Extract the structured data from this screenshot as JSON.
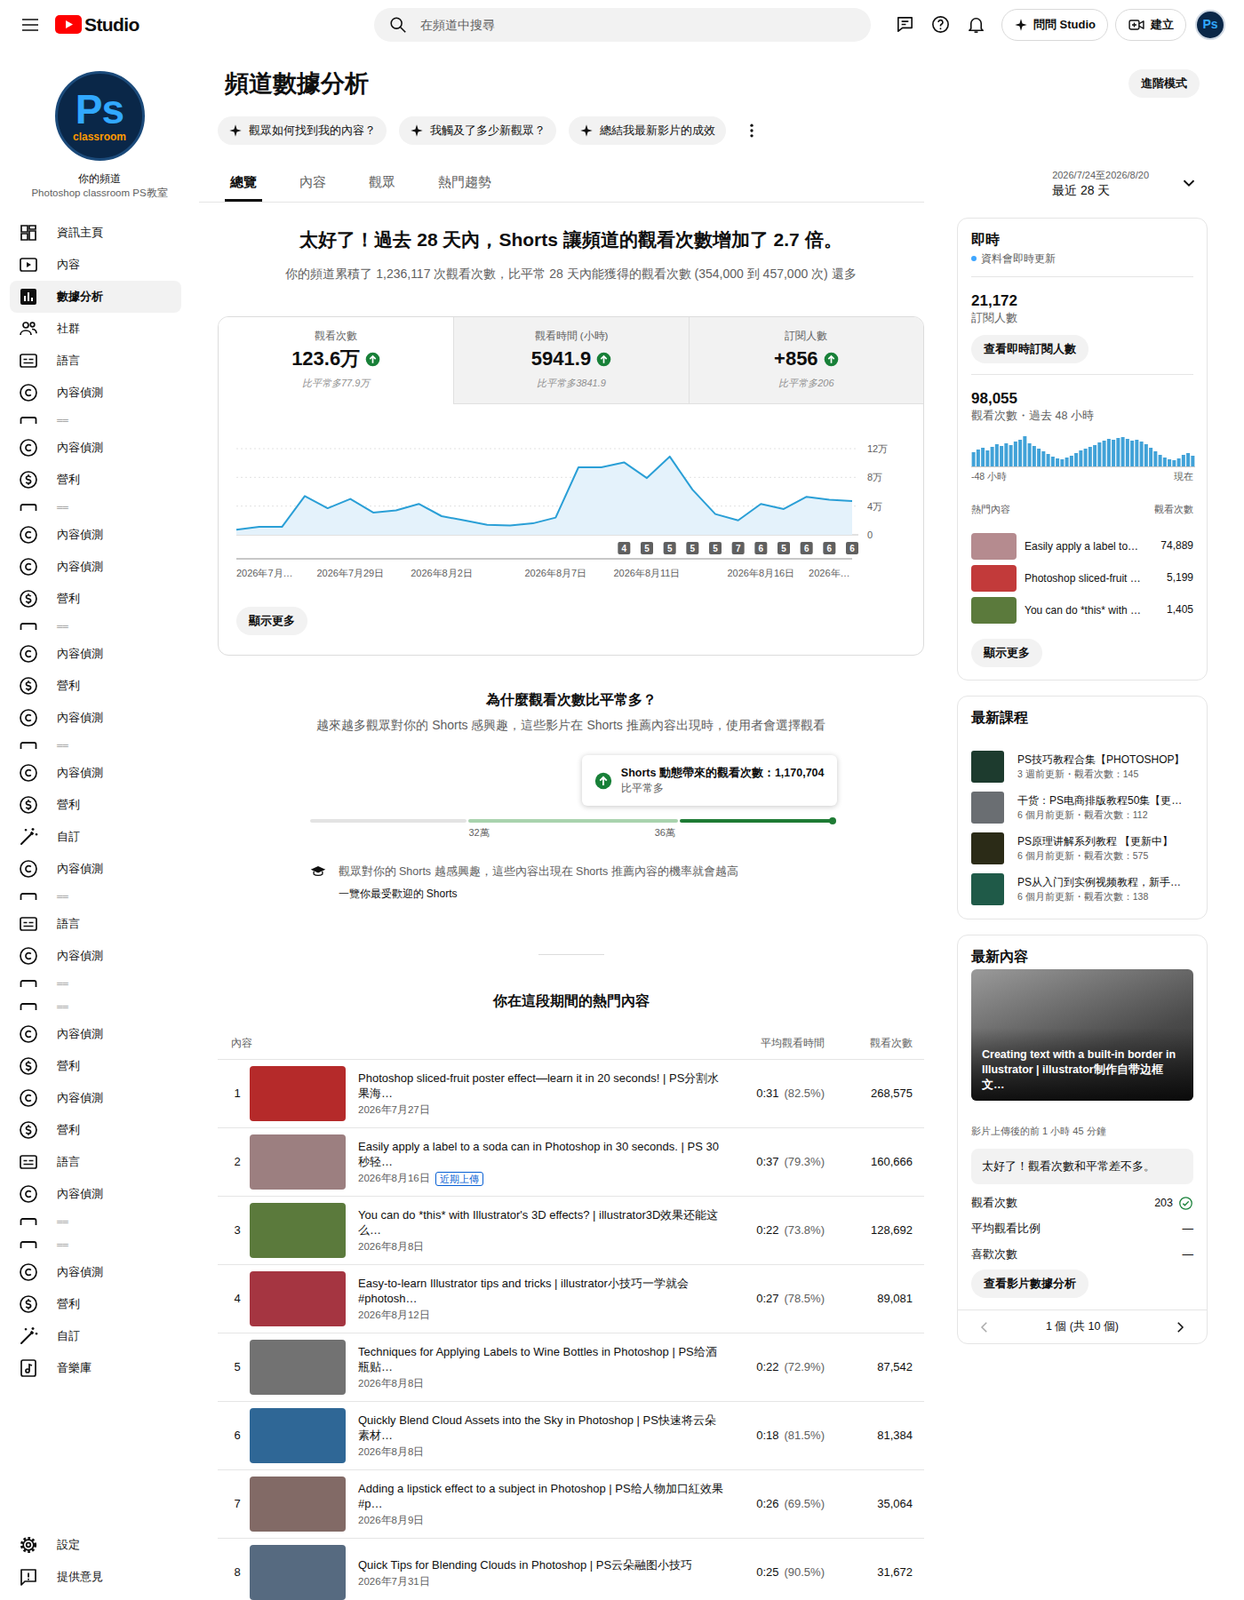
{
  "topbar": {
    "logo": "Studio",
    "search": {
      "placeholder": "在頻道中搜尋"
    },
    "ask_button": "問問 Studio",
    "create_button": "建立",
    "avatar": "Ps"
  },
  "channel": {
    "avatar_text": "Ps",
    "avatar_sub": "classroom",
    "label": "你的頻道",
    "name": "Photoshop classroom PS教室"
  },
  "sidebar": {
    "items": [
      {
        "kind": "dashboard",
        "label": "資訊主頁",
        "selected": false
      },
      {
        "kind": "content",
        "label": "內容",
        "selected": false
      },
      {
        "kind": "analytics",
        "label": "數據分析",
        "selected": true
      },
      {
        "kind": "community",
        "label": "社群",
        "selected": false
      },
      {
        "kind": "subtitles",
        "label": "語言",
        "selected": false
      },
      {
        "kind": "copyright",
        "label": "內容偵測",
        "selected": false
      },
      {
        "kind": "fragment",
        "label": "══",
        "selected": false
      },
      {
        "kind": "copyright",
        "label": "內容偵測",
        "selected": false
      },
      {
        "kind": "monetization",
        "label": "營利",
        "selected": false
      },
      {
        "kind": "fragment",
        "label": "══",
        "selected": false
      },
      {
        "kind": "copyright",
        "label": "內容偵測",
        "selected": false
      },
      {
        "kind": "copyright",
        "label": "內容偵測",
        "selected": false
      },
      {
        "kind": "monetization",
        "label": "營利",
        "selected": false
      },
      {
        "kind": "fragment",
        "label": "══",
        "selected": false
      },
      {
        "kind": "copyright",
        "label": "內容偵測",
        "selected": false
      },
      {
        "kind": "monetization",
        "label": "營利",
        "selected": false
      },
      {
        "kind": "copyright",
        "label": "內容偵測",
        "selected": false
      },
      {
        "kind": "fragment",
        "label": "══",
        "selected": false
      },
      {
        "kind": "copyright",
        "label": "內容偵測",
        "selected": false
      },
      {
        "kind": "monetization",
        "label": "營利",
        "selected": false
      },
      {
        "kind": "customization",
        "label": "自訂",
        "selected": false
      },
      {
        "kind": "copyright",
        "label": "內容偵測",
        "selected": false
      },
      {
        "kind": "fragment",
        "label": "══",
        "selected": false
      },
      {
        "kind": "subtitles",
        "label": "語言",
        "selected": false
      },
      {
        "kind": "copyright",
        "label": "內容偵測",
        "selected": false
      },
      {
        "kind": "fragment",
        "label": "══",
        "selected": false
      },
      {
        "kind": "fragment",
        "label": "══",
        "selected": false
      },
      {
        "kind": "copyright",
        "label": "內容偵測",
        "selected": false
      },
      {
        "kind": "monetization",
        "label": "營利",
        "selected": false
      },
      {
        "kind": "copyright",
        "label": "內容偵測",
        "selected": false
      },
      {
        "kind": "monetization",
        "label": "營利",
        "selected": false
      },
      {
        "kind": "subtitles",
        "label": "語言",
        "selected": false
      },
      {
        "kind": "copyright",
        "label": "內容偵測",
        "selected": false
      },
      {
        "kind": "fragment",
        "label": "══",
        "selected": false
      },
      {
        "kind": "fragment",
        "label": "══",
        "selected": false
      },
      {
        "kind": "copyright",
        "label": "內容偵測",
        "selected": false
      },
      {
        "kind": "monetization",
        "label": "營利",
        "selected": false
      },
      {
        "kind": "customization",
        "label": "自訂",
        "selected": false
      },
      {
        "kind": "audio",
        "label": "音樂庫",
        "selected": false
      }
    ],
    "footer": [
      {
        "kind": "settings",
        "label": "設定",
        "selected": false
      },
      {
        "kind": "feedback",
        "label": "提供意見",
        "selected": false
      }
    ]
  },
  "header": {
    "title": "頻道數據分析",
    "advanced_button": "進階模式",
    "chips": [
      "觀眾如何找到我的內容？",
      "我觸及了多少新觀眾？",
      "總結我最新影片的成效"
    ],
    "tabs": [
      {
        "label": "總覽",
        "selected": true
      },
      {
        "label": "內容",
        "selected": false
      },
      {
        "label": "觀眾",
        "selected": false
      },
      {
        "label": "熱門趨勢",
        "selected": false
      }
    ],
    "date_range": {
      "dates": "2026/7/24至2026/8/20",
      "label": "最近 28 天"
    }
  },
  "summary": {
    "headline": "太好了！過去 28 天內，Shorts 讓頻道的觀看次數增加了 2.7 倍。",
    "subtitle": "你的頻道累積了 1,236,117 次觀看次數，比平常 28 天內能獲得的觀看次數 (354,000 到 457,000 次) 還多"
  },
  "metrics": [
    {
      "label": "觀看次數",
      "value": "123.6万",
      "compare": "比平常多77.9万",
      "up": true,
      "selected": true
    },
    {
      "label": "觀看時間 (小時)",
      "value": "5941.9",
      "compare": "比平常多3841.9",
      "up": true,
      "selected": false
    },
    {
      "label": "訂閱人數",
      "value": "+856",
      "compare": "比平常多206",
      "up": true,
      "selected": false
    }
  ],
  "chart": {
    "y_ticks": [
      {
        "label": "12万",
        "value": 12
      },
      {
        "label": "8万",
        "value": 8
      },
      {
        "label": "4万",
        "value": 4
      },
      {
        "label": "0",
        "value": 0
      }
    ],
    "values": [
      0.7,
      1.1,
      1.1,
      5.4,
      3.7,
      5.0,
      3.1,
      3.4,
      4.3,
      2.6,
      2.0,
      1.4,
      1.3,
      1.6,
      2.4,
      9.4,
      9.4,
      10.1,
      7.9,
      10.9,
      6.3,
      2.9,
      2.0,
      4.3,
      3.6,
      5.3,
      4.9,
      4.7
    ],
    "x_labels": [
      {
        "label": "2026年7月…",
        "index": 0
      },
      {
        "label": "2026年7月29日",
        "index": 5
      },
      {
        "label": "2026年8月2日",
        "index": 9
      },
      {
        "label": "2026年8月7日",
        "index": 14
      },
      {
        "label": "2026年8月11日",
        "index": 18
      },
      {
        "label": "2026年8月16日",
        "index": 23
      },
      {
        "label": "2026年…",
        "index": 26
      }
    ],
    "markers": [
      {
        "label": "4",
        "index": 17
      },
      {
        "label": "5",
        "index": 18
      },
      {
        "label": "5",
        "index": 19
      },
      {
        "label": "5",
        "index": 20
      },
      {
        "label": "5",
        "index": 21
      },
      {
        "label": "7",
        "index": 22
      },
      {
        "label": "6",
        "index": 23
      },
      {
        "label": "5",
        "index": 24
      },
      {
        "label": "6",
        "index": 25
      },
      {
        "label": "6",
        "index": 26
      },
      {
        "label": "6",
        "index": 27
      }
    ],
    "more_button": "顯示更多"
  },
  "why": {
    "title": "為什麼觀看次數比平常多？",
    "subtitle": "越來越多觀眾對你的 Shorts 感興趣，這些影片在 Shorts 推薦內容出現時，使用者會選擇觀看",
    "tooltip": {
      "text": "Shorts 動態帶來的觀看次數：1,170,704",
      "sub": "比平常多",
      "up": true
    },
    "range": {
      "segments": [
        {
          "share": 0.303,
          "color": "#e3e3e3"
        },
        {
          "share": 0.404,
          "color": "#a9d3ae"
        },
        {
          "share": 0.293,
          "color": "#1e7b34"
        }
      ],
      "labels": [
        {
          "label": "32萬",
          "position": 0.324
        },
        {
          "label": "36萬",
          "position": 0.68
        }
      ]
    },
    "tip": {
      "text": "觀眾對你的 Shorts 越感興趣，這些內容出現在 Shorts 推薦內容的機率就會越高",
      "link": "一覽你最受歡迎的 Shorts"
    }
  },
  "top_content": {
    "title": "你在這段期間的熱門內容",
    "columns": [
      "內容",
      "平均觀看時間",
      "觀看次數"
    ],
    "rows": [
      {
        "rank": "1",
        "title": "Photoshop sliced-fruit poster effect—learn it in 20 seconds! | PS分割水果海…",
        "date": "2026年7月27日",
        "avg": "0:31",
        "avg_pct": "(82.5%)",
        "views": "268,575",
        "color": "#b52a2a"
      },
      {
        "rank": "2",
        "title": "Easily apply a label to a soda can in Photoshop in 30 seconds. | PS 30秒轻…",
        "date": "2026年8月16日",
        "badge": "近期上傳",
        "avg": "0:37",
        "avg_pct": "(79.3%)",
        "views": "160,666",
        "color": "#9c7f80"
      },
      {
        "rank": "3",
        "title": "You can do *this* with Illustrator's 3D effects? | illustrator3D效果还能这么…",
        "date": "2026年8月8日",
        "avg": "0:22",
        "avg_pct": "(73.8%)",
        "views": "128,692",
        "color": "#5b7a3c"
      },
      {
        "rank": "4",
        "title": "Easy-to-learn Illustrator tips and tricks | illustrator小技巧一学就会 #photosh…",
        "date": "2026年8月12日",
        "avg": "0:27",
        "avg_pct": "(78.5%)",
        "views": "89,081",
        "color": "#a53541"
      },
      {
        "rank": "5",
        "title": "Techniques for Applying Labels to Wine Bottles in Photoshop | PS给酒瓶贴…",
        "date": "2026年8月8日",
        "avg": "0:22",
        "avg_pct": "(72.9%)",
        "views": "87,542",
        "color": "#727272"
      },
      {
        "rank": "6",
        "title": "Quickly Blend Cloud Assets into the Sky in Photoshop | PS快速将云朵素材…",
        "date": "2026年8月8日",
        "avg": "0:18",
        "avg_pct": "(81.5%)",
        "views": "81,384",
        "color": "#2f6796"
      },
      {
        "rank": "7",
        "title": "Adding a lipstick effect to a subject in Photoshop | PS给人物加口紅效果 #p…",
        "date": "2026年8月9日",
        "avg": "0:26",
        "avg_pct": "(69.5%)",
        "views": "35,064",
        "color": "#826a66"
      },
      {
        "rank": "8",
        "title": "Quick Tips for Blending Clouds in Photoshop | PS云朵融图小技巧",
        "date": "2026年7月31日",
        "avg": "0:25",
        "avg_pct": "(90.5%)",
        "views": "31,672",
        "color": "#566a80"
      }
    ]
  },
  "realtime": {
    "title": "即時",
    "live_note": "資料會即時更新",
    "subscribers": "21,172",
    "subscribers_label": "訂閱人數",
    "subscribers_button": "查看即時訂閱人數",
    "views": "98,055",
    "views_label": "觀看次數・過去 48 小時",
    "bars": [
      1600,
      1900,
      2100,
      1800,
      2200,
      2500,
      2300,
      2600,
      2400,
      2800,
      3000,
      3400,
      2600,
      2300,
      2000,
      1700,
      1400,
      1100,
      900,
      800,
      1000,
      1200,
      1500,
      1800,
      2000,
      2200,
      2400,
      2700,
      2900,
      3100,
      3000,
      3200,
      3300,
      3100,
      2900,
      3000,
      2800,
      2500,
      2100,
      1700,
      1300,
      1000,
      800,
      700,
      900,
      1300,
      1500,
      1200
    ],
    "axis_start": "-48 小時",
    "axis_end": "現在",
    "top_header": "熱門內容",
    "top_views_header": "觀看次數",
    "top": [
      {
        "title": "Easily apply a label to…",
        "views": "74,889",
        "color": "#b58b8f"
      },
      {
        "title": "Photoshop sliced-fruit …",
        "views": "5,199",
        "color": "#c23a3a"
      },
      {
        "title": "You can do *this* with …",
        "views": "1,405",
        "color": "#5b7a3c"
      }
    ],
    "more_button": "顯示更多"
  },
  "courses": {
    "title": "最新課程",
    "items": [
      {
        "title": "PS技巧教程合集【PHOTOSHOP】",
        "meta": "3 週前更新・觀看次數：145",
        "color": "#1d3b2e"
      },
      {
        "title": "干货：PS电商排版教程50集【更…",
        "meta": "6 個月前更新・觀看次數：112",
        "color": "#6a6e72"
      },
      {
        "title": "PS原理讲解系列教程 【更新中】",
        "meta": "6 個月前更新・觀看次數：575",
        "color": "#2b2b17"
      },
      {
        "title": "PS从入门到实例视频教程，新手…",
        "meta": "6 個月前更新・觀看次數：138",
        "color": "#1f5a48"
      }
    ]
  },
  "latest": {
    "title": "最新內容",
    "video_title": "Creating text with a built-in border in Illustrator | illustrator制作自带边框文…",
    "since": "影片上傳後的前 1 小時 45 分鐘",
    "verdict": "太好了！觀看次數和平常差不多。",
    "stats": [
      {
        "label": "觀看次數",
        "value": "203",
        "ok": true
      },
      {
        "label": "平均觀看比例",
        "value": "—",
        "ok": false
      },
      {
        "label": "喜歡次數",
        "value": "—",
        "ok": false
      }
    ],
    "button": "查看影片數據分析",
    "pager": "1 個 (共 10 個)",
    "prev_disabled": true,
    "next_disabled": false
  }
}
